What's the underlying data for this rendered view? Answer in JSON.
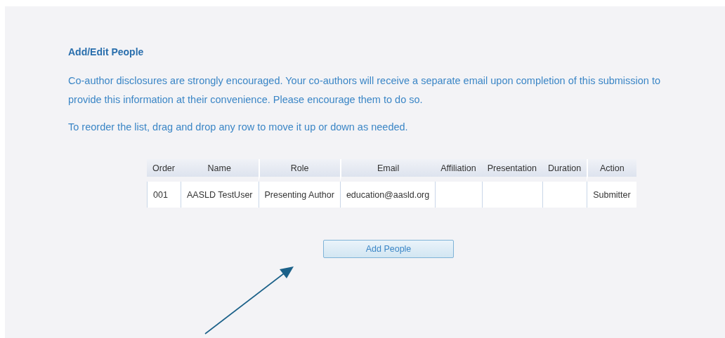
{
  "heading": "Add/Edit People",
  "paragraphs": [
    "Co-author disclosures are strongly encouraged. Your co-authors will receive a separate email upon completion of this submission to provide this information at their convenience. Please encourage them to do so.",
    "To reorder the list, drag and drop any row to move it up or down as needed."
  ],
  "table": {
    "columns": [
      "Order",
      "Name",
      "Role",
      "Email",
      "Affiliation",
      "Presentation",
      "Duration",
      "Action"
    ],
    "rows": [
      [
        "001",
        "AASLD TestUser",
        "Presenting Author",
        "education@aasld.org",
        "",
        "",
        "",
        "Submitter"
      ]
    ]
  },
  "button": "Add People"
}
